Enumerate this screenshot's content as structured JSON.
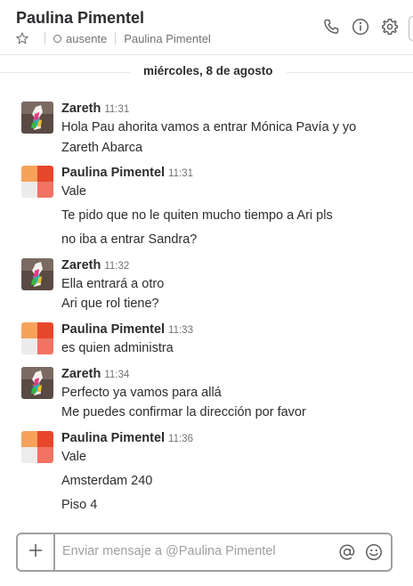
{
  "header": {
    "title": "Paulina Pimentel",
    "presence": "ausente",
    "full_name": "Paulina Pimentel",
    "icons": [
      "star-icon",
      "presence-icon",
      "phone-icon",
      "info-icon",
      "gear-icon"
    ]
  },
  "date_divider": "miércoles, 8 de agosto",
  "messages": [
    {
      "sender": "Zareth",
      "time": "11:31",
      "lines": [
        "Hola Pau ahorita vamos a entrar Mónica Pavía y yo",
        "Zareth Abarca"
      ]
    },
    {
      "sender": "Paulina Pimentel",
      "time": "11:31",
      "lines": [
        "Vale",
        "Te pido que no le quiten mucho tiempo a Ari pls",
        "no iba a entrar Sandra?"
      ]
    },
    {
      "sender": "Zareth",
      "time": "11:32",
      "lines": [
        "Ella entrará a otro",
        "Ari que rol tiene?"
      ]
    },
    {
      "sender": "Paulina Pimentel",
      "time": "11:33",
      "lines": [
        "es quien administra"
      ]
    },
    {
      "sender": "Zareth",
      "time": "11:34",
      "lines": [
        "Perfecto ya vamos para allá",
        "Me puedes confirmar la dirección por favor"
      ]
    },
    {
      "sender": "Paulina Pimentel",
      "time": "11:36",
      "lines": [
        "Vale",
        "Amsterdam 240",
        "Piso 4"
      ]
    }
  ],
  "composer": {
    "placeholder": "Enviar mensaje a @Paulina Pimentel",
    "icons": [
      "plus-icon",
      "mention-icon",
      "emoji-icon"
    ]
  },
  "colors": {
    "text": "#2c2d30",
    "muted": "#717274",
    "avatar_orange_light": "#f7a25a",
    "avatar_orange_dark": "#e8462b",
    "avatar_red_light": "#f07363",
    "composer_border": "#a0a0a2"
  }
}
